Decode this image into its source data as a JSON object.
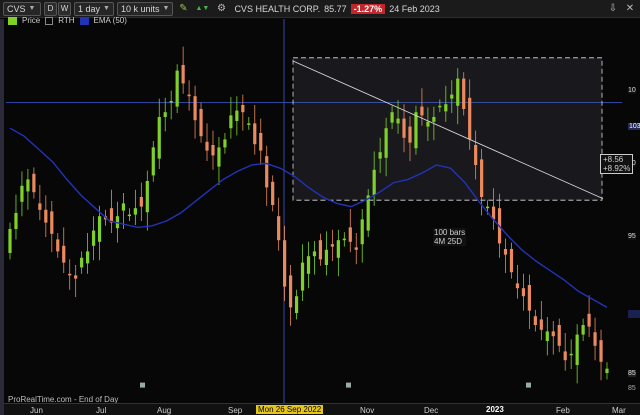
{
  "toolbar": {
    "ticker": "CVS",
    "mode_d": "D",
    "mode_w": "W",
    "interval": "1 day",
    "units": "10 k units",
    "company": "CVS HEALTH CORP.",
    "price": "85.77",
    "change": "-1.27%",
    "date": "24 Feb 2023",
    "icons": [
      "settings-icon",
      "download-icon",
      "window-icon",
      "close-icon"
    ]
  },
  "legend": {
    "price_label": "Price",
    "rth_label": "RTH",
    "ema_label": "EMA (50)"
  },
  "colors": {
    "up": "#7fd12a",
    "down": "#e98a5f",
    "ema": "#2233b8",
    "trendline": "#d8d8d8",
    "crosshair": "#3c5bcf"
  },
  "chart": {
    "y_ticks": [
      "10",
      "10",
      "10",
      "95",
      "90",
      "85"
    ],
    "x_ticks": [
      "Jun",
      "Jul",
      "Aug",
      "Sep",
      "Mon 26 Sep 2022",
      "Nov",
      "Dec",
      "2023",
      "Feb",
      "Mar"
    ],
    "crosshair_value": "103",
    "measure_top": "+8.56",
    "measure_bottom": "+8.92%",
    "bars_label": "100 bars",
    "bars_duration": "4M 25D",
    "footer": "ProRealTime.com - End of Day",
    "price_badge": "85"
  },
  "chart_data": {
    "type": "candlestick",
    "x_range": [
      "Jun 2022",
      "Mar 2023"
    ],
    "series": [
      {
        "name": "Price",
        "values": [
          94.5,
          95.5,
          97.2,
          97.6,
          96.8,
          95.7,
          94.9,
          94.2,
          93.1,
          92.4,
          91.6,
          91.4,
          92.7,
          93.1,
          94.4,
          95.3,
          95.1,
          94.9,
          95.3,
          96.1,
          95.4,
          95.8,
          95.9,
          97.5,
          99.6,
          101.5,
          101.8,
          102.5,
          104.4,
          103.6,
          102.8,
          101.3,
          100.3,
          99.4,
          99.1,
          99.6,
          100.1,
          101.6,
          101.9,
          101.8,
          101.1,
          99.8,
          99.4,
          97.1,
          96.0,
          93.8,
          90.9,
          89.6,
          90.3,
          92.4,
          92.8,
          93.1,
          92.6,
          93.2,
          93.4,
          93.8,
          93.9,
          93.7,
          93.2,
          95.1,
          96.6,
          98.2,
          99.3,
          100.8,
          101.8,
          101.4,
          100.2,
          99.9,
          101.8,
          101.6,
          101.2,
          101.5,
          102.2,
          102.3,
          102.9,
          103.9,
          102.0,
          100.1,
          98.5,
          96.5,
          95.9,
          95.1,
          93.6,
          92.9,
          91.8,
          90.8,
          90.3,
          89.4,
          88.5,
          88.2,
          88.1,
          87.8,
          87.2,
          86.3,
          86.7,
          87.9,
          88.5,
          88.4,
          87.2,
          86.2,
          85.77
        ]
      },
      {
        "name": "EMA (50)",
        "values": [
          100.8,
          100.3,
          99.5,
          98.7,
          97.6,
          96.6,
          95.8,
          95.0,
          94.8,
          94.6,
          94.7,
          95.0,
          95.5,
          96.2,
          96.9,
          97.6,
          98.1,
          98.5,
          98.6,
          98.3,
          97.8,
          97.1,
          96.5,
          96.1,
          95.9,
          96.3,
          96.8,
          97.4,
          97.6,
          98.0,
          98.5,
          98.3,
          97.4,
          96.2,
          95.1,
          94.1,
          93.2,
          92.5,
          91.9,
          91.3,
          90.6,
          90.1,
          89.6
        ]
      }
    ],
    "ylim": [
      84,
      107
    ],
    "annotations": [
      "+8.56",
      "+8.92%",
      "100 bars",
      "4M 25D"
    ]
  }
}
